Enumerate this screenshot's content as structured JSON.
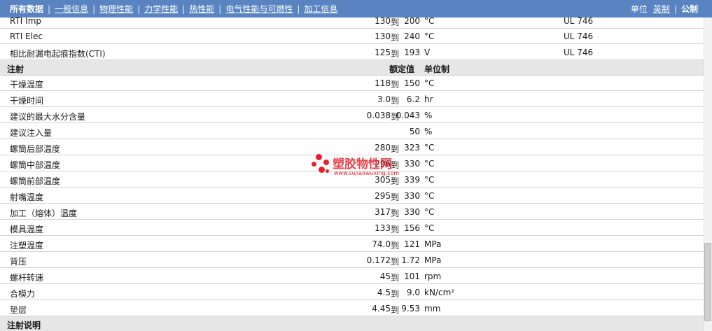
{
  "nav": {
    "tabs": [
      {
        "label": "所有数据"
      },
      {
        "label": "一般信息"
      },
      {
        "label": "物理性能"
      },
      {
        "label": "力学性能"
      },
      {
        "label": "热性能"
      },
      {
        "label": "电气性能与可燃性"
      },
      {
        "label": "加工信息"
      }
    ],
    "separator": "|",
    "units_label": "单位",
    "units_english": "英制",
    "units_metric": "公制"
  },
  "electrical_rows": [
    {
      "name": "RTI Imp",
      "low": "130",
      "to": "到",
      "high": "200",
      "unit": "°C",
      "standard": "UL 746"
    },
    {
      "name": "RTI Elec",
      "low": "130",
      "to": "到",
      "high": "240",
      "unit": "°C",
      "standard": "UL 746"
    },
    {
      "name": "相比耐漏电起痕指数(CTI)",
      "low": "125",
      "to": "到",
      "high": "193",
      "unit": "V",
      "standard": "UL 746"
    }
  ],
  "injection_section": {
    "title": "注射",
    "header_value": "额定值",
    "header_unit": "单位制"
  },
  "injection_rows": [
    {
      "name": "干燥温度",
      "low": "118",
      "to": "到",
      "high": "150",
      "unit": "°C"
    },
    {
      "name": "干燥时间",
      "low": "3.0",
      "to": "到",
      "high": "6.2",
      "unit": "hr"
    },
    {
      "name": "建议的最大水分含量",
      "low": "0.038",
      "to": "到",
      "high": "0.043",
      "unit": "%"
    },
    {
      "name": "建议注入量",
      "single": "50",
      "unit": "%"
    },
    {
      "name": "螺筒后部温度",
      "low": "280",
      "to": "到",
      "high": "323",
      "unit": "°C"
    },
    {
      "name": "螺筒中部温度",
      "low": "296",
      "to": "到",
      "high": "330",
      "unit": "°C"
    },
    {
      "name": "螺筒前部温度",
      "low": "305",
      "to": "到",
      "high": "339",
      "unit": "°C"
    },
    {
      "name": "射嘴温度",
      "low": "295",
      "to": "到",
      "high": "330",
      "unit": "°C"
    },
    {
      "name": "加工（熔体）温度",
      "low": "317",
      "to": "到",
      "high": "330",
      "unit": "°C"
    },
    {
      "name": "模具温度",
      "low": "133",
      "to": "到",
      "high": "156",
      "unit": "°C"
    },
    {
      "name": "注塑温度",
      "low": "74.0",
      "to": "到",
      "high": "121",
      "unit": "MPa"
    },
    {
      "name": "背压",
      "low": "0.172",
      "to": "到",
      "high": "1.72",
      "unit": "MPa"
    },
    {
      "name": "螺杆转速",
      "low": "45",
      "to": "到",
      "high": "101",
      "unit": "rpm"
    },
    {
      "name": "合模力",
      "low": "4.5",
      "to": "到",
      "high": "9.0",
      "unit": "kN/cm²"
    },
    {
      "name": "垫层",
      "low": "4.45",
      "to": "到",
      "high": "9.53",
      "unit": "mm"
    }
  ],
  "notes_section": {
    "title": "注射说明"
  },
  "watermark": {
    "text": "塑胶物性网",
    "url": "www.sujiaowuxing.com",
    "color": "#e8202a"
  },
  "colors": {
    "nav_bg": "#5a84c1",
    "section_bg": "#e6e6e6",
    "row_border": "#d4d4d4"
  }
}
